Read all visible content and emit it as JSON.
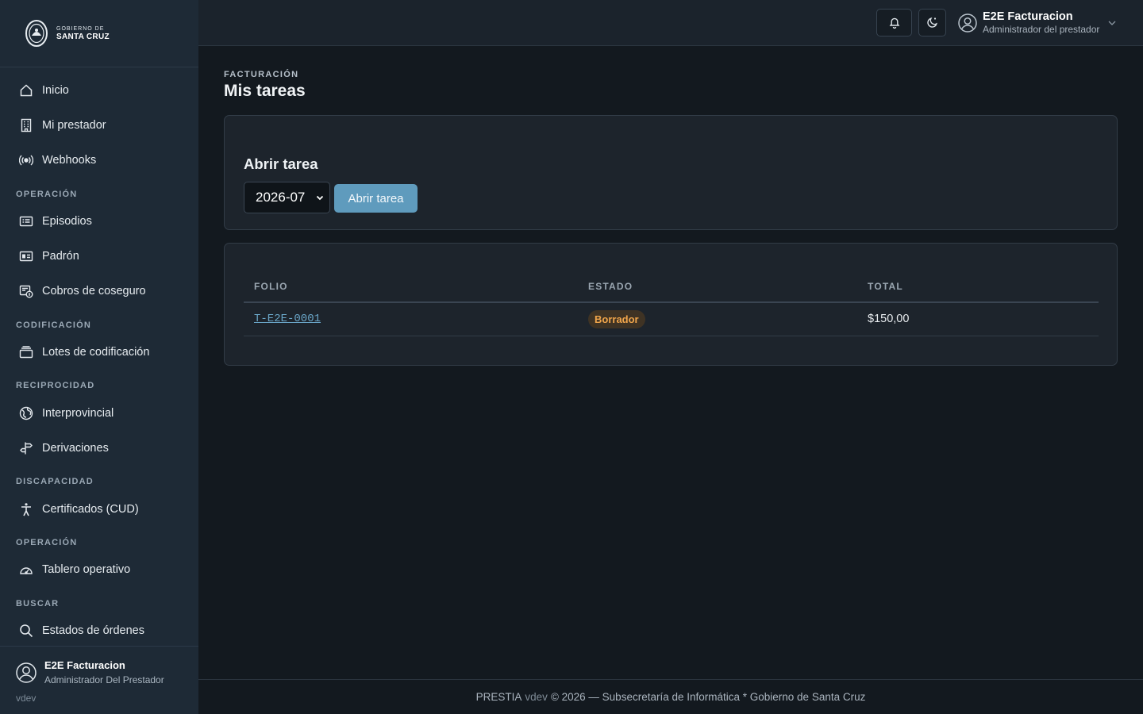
{
  "logo": {
    "line1": "GOBIERNO DE",
    "line2": "SANTA CRUZ"
  },
  "sidebar": {
    "items_top": [
      {
        "label": "Inicio",
        "icon": "home-icon"
      },
      {
        "label": "Mi prestador",
        "icon": "building-icon"
      },
      {
        "label": "Webhooks",
        "icon": "broadcast-icon"
      }
    ],
    "sections": [
      {
        "title": "OPERACIÓN",
        "items": [
          {
            "label": "Episodios",
            "icon": "card-list-icon"
          },
          {
            "label": "Padrón",
            "icon": "id-card-icon"
          },
          {
            "label": "Cobros de coseguro",
            "icon": "receipt-coin-icon"
          }
        ]
      },
      {
        "title": "CODIFICACIÓN",
        "items": [
          {
            "label": "Lotes de codificación",
            "icon": "stack-icon"
          }
        ]
      },
      {
        "title": "RECIPROCIDAD",
        "items": [
          {
            "label": "Interprovincial",
            "icon": "globe-icon"
          },
          {
            "label": "Derivaciones",
            "icon": "signpost-icon"
          }
        ]
      },
      {
        "title": "DISCAPACIDAD",
        "items": [
          {
            "label": "Certificados (CUD)",
            "icon": "accessibility-icon"
          }
        ]
      },
      {
        "title": "OPERACIÓN",
        "items": [
          {
            "label": "Tablero operativo",
            "icon": "speedometer-icon"
          }
        ]
      },
      {
        "title": "BUSCAR",
        "items": [
          {
            "label": "Estados de órdenes",
            "icon": "search-icon"
          }
        ]
      }
    ],
    "user": {
      "name": "E2E Facturacion",
      "role": "Administrador Del Prestador"
    },
    "version": "vdev"
  },
  "topbar": {
    "user_name": "E2E Facturacion",
    "user_role": "Administrador del prestador"
  },
  "page": {
    "breadcrumb": "FACTURACIÓN",
    "title": "Mis tareas"
  },
  "open_task": {
    "title": "Abrir tarea",
    "selected_period": "2026-07",
    "button_label": "Abrir tarea"
  },
  "table": {
    "headers": [
      "FOLIO",
      "ESTADO",
      "TOTAL"
    ],
    "rows": [
      {
        "folio": "T-E2E-0001",
        "estado": "Borrador",
        "total": "$150,00"
      }
    ],
    "badge_color": "#f0a54b"
  },
  "footer": {
    "brand": "PRESTIA",
    "version": "vdev",
    "text": "© 2026 — Subsecretaría de Informática * Gobierno de Santa Cruz"
  },
  "colors": {
    "sidebar_bg": "#1e2a36",
    "page_bg": "#13191f",
    "accent": "#5f9bbd",
    "link": "#6aa6c8"
  }
}
